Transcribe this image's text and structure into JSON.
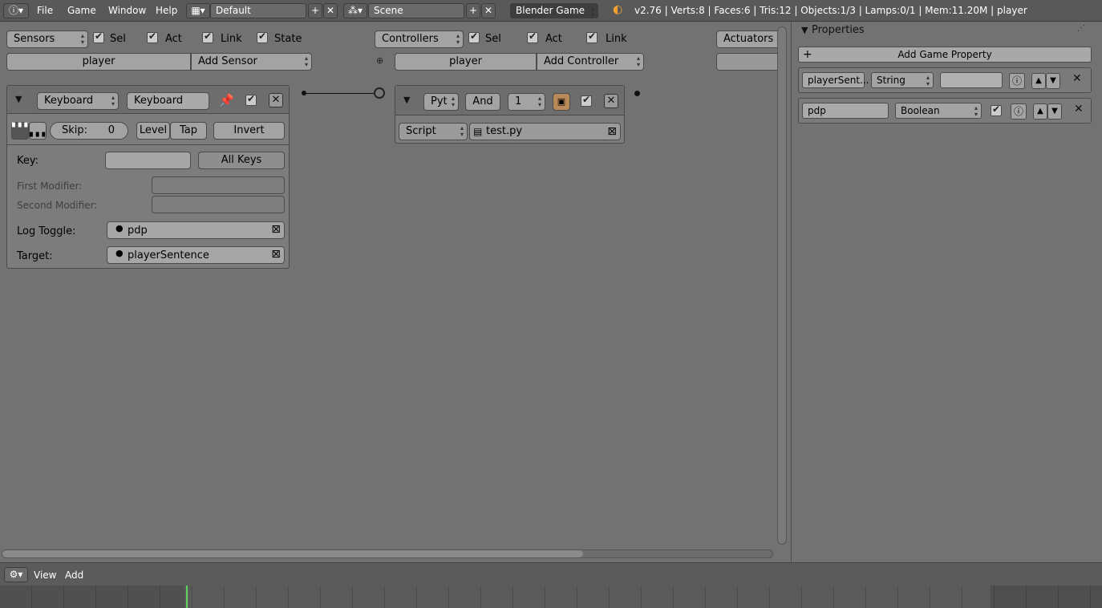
{
  "topbar": {
    "info_icon": "info-icon",
    "menus": [
      "File",
      "Game",
      "Window",
      "Help"
    ],
    "screen_layout": "Default",
    "scene": "Scene",
    "engine": "Blender Game",
    "stats": "v2.76 | Verts:8 | Faces:6 | Tris:12 | Objects:1/3 | Lamps:0/1 | Mem:11.20M | player"
  },
  "sensors": {
    "header": "Sensors",
    "sel": "Sel",
    "act": "Act",
    "link": "Link",
    "state": "State",
    "object": "player",
    "add": "Add Sensor",
    "brick": {
      "type": "Keyboard",
      "name": "Keyboard",
      "skip_label": "Skip:",
      "skip_value": "0",
      "level": "Level",
      "tap": "Tap",
      "invert": "Invert",
      "key_label": "Key:",
      "all_keys": "All Keys",
      "first_mod_label": "First Modifier:",
      "second_mod_label": "Second Modifier:",
      "log_toggle_label": "Log Toggle:",
      "log_toggle_value": "pdp",
      "target_label": "Target:",
      "target_value": "playerSentence"
    }
  },
  "controllers": {
    "header": "Controllers",
    "sel": "Sel",
    "act": "Act",
    "link": "Link",
    "object": "player",
    "add": "Add Controller",
    "brick": {
      "type": "Pyt",
      "name": "And",
      "state": "1",
      "mode": "Script",
      "script": "test.py"
    }
  },
  "actuators": {
    "header": "Actuators"
  },
  "properties": {
    "title": "Properties",
    "add": "Add Game Property",
    "items": [
      {
        "name": "playerSent...",
        "type": "String",
        "value": ""
      },
      {
        "name": "pdp",
        "type": "Boolean",
        "value": "checked"
      }
    ]
  },
  "footer": {
    "menus": [
      "View",
      "Add"
    ]
  }
}
